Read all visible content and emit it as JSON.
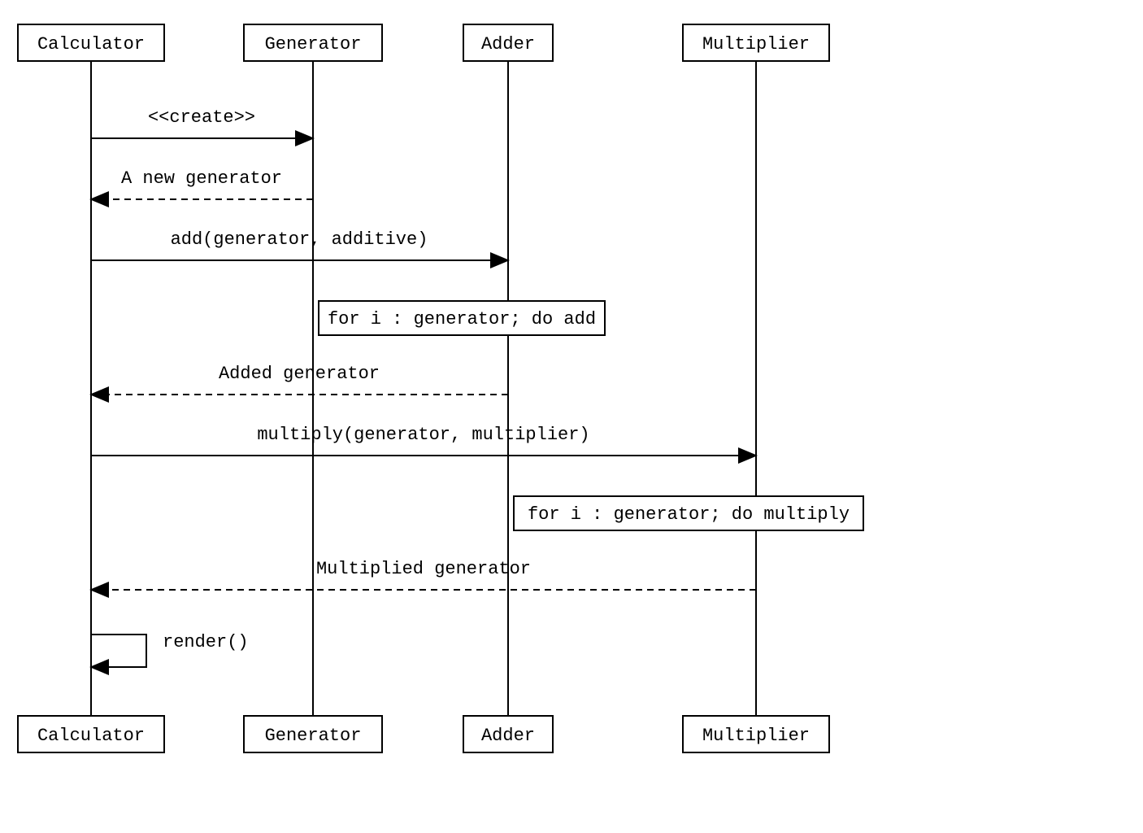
{
  "chart_data": {
    "type": "sequence-diagram",
    "participants": [
      "Calculator",
      "Generator",
      "Adder",
      "Multiplier"
    ],
    "messages": [
      {
        "from": "Calculator",
        "to": "Generator",
        "label": "<<create>>",
        "type": "solid"
      },
      {
        "from": "Generator",
        "to": "Calculator",
        "label": "A new generator",
        "type": "dashed"
      },
      {
        "from": "Calculator",
        "to": "Adder",
        "label": "add(generator, additive)",
        "type": "solid"
      },
      {
        "note_over": [
          "Generator",
          "Adder"
        ],
        "label": "for i : generator; do add"
      },
      {
        "from": "Adder",
        "to": "Calculator",
        "label": "Added generator",
        "type": "dashed"
      },
      {
        "from": "Calculator",
        "to": "Multiplier",
        "label": "multiply(generator, multiplier)",
        "type": "solid"
      },
      {
        "note_over": [
          "Adder",
          "Multiplier"
        ],
        "label": "for i : generator; do multiply"
      },
      {
        "from": "Multiplier",
        "to": "Calculator",
        "label": "Multiplied generator",
        "type": "dashed"
      },
      {
        "from": "Calculator",
        "to": "Calculator",
        "label": "render()",
        "type": "self"
      }
    ]
  },
  "participants": {
    "p0": "Calculator",
    "p1": "Generator",
    "p2": "Adder",
    "p3": "Multiplier"
  },
  "messages": {
    "m0": "<<create>>",
    "m1": "A new generator",
    "m2": "add(generator, additive)",
    "m3": "Added generator",
    "m4": "multiply(generator, multiplier)",
    "m5": "Multiplied generator",
    "m6": "render()"
  },
  "notes": {
    "n0": "for i : generator; do add",
    "n1": "for i : generator; do multiply"
  }
}
